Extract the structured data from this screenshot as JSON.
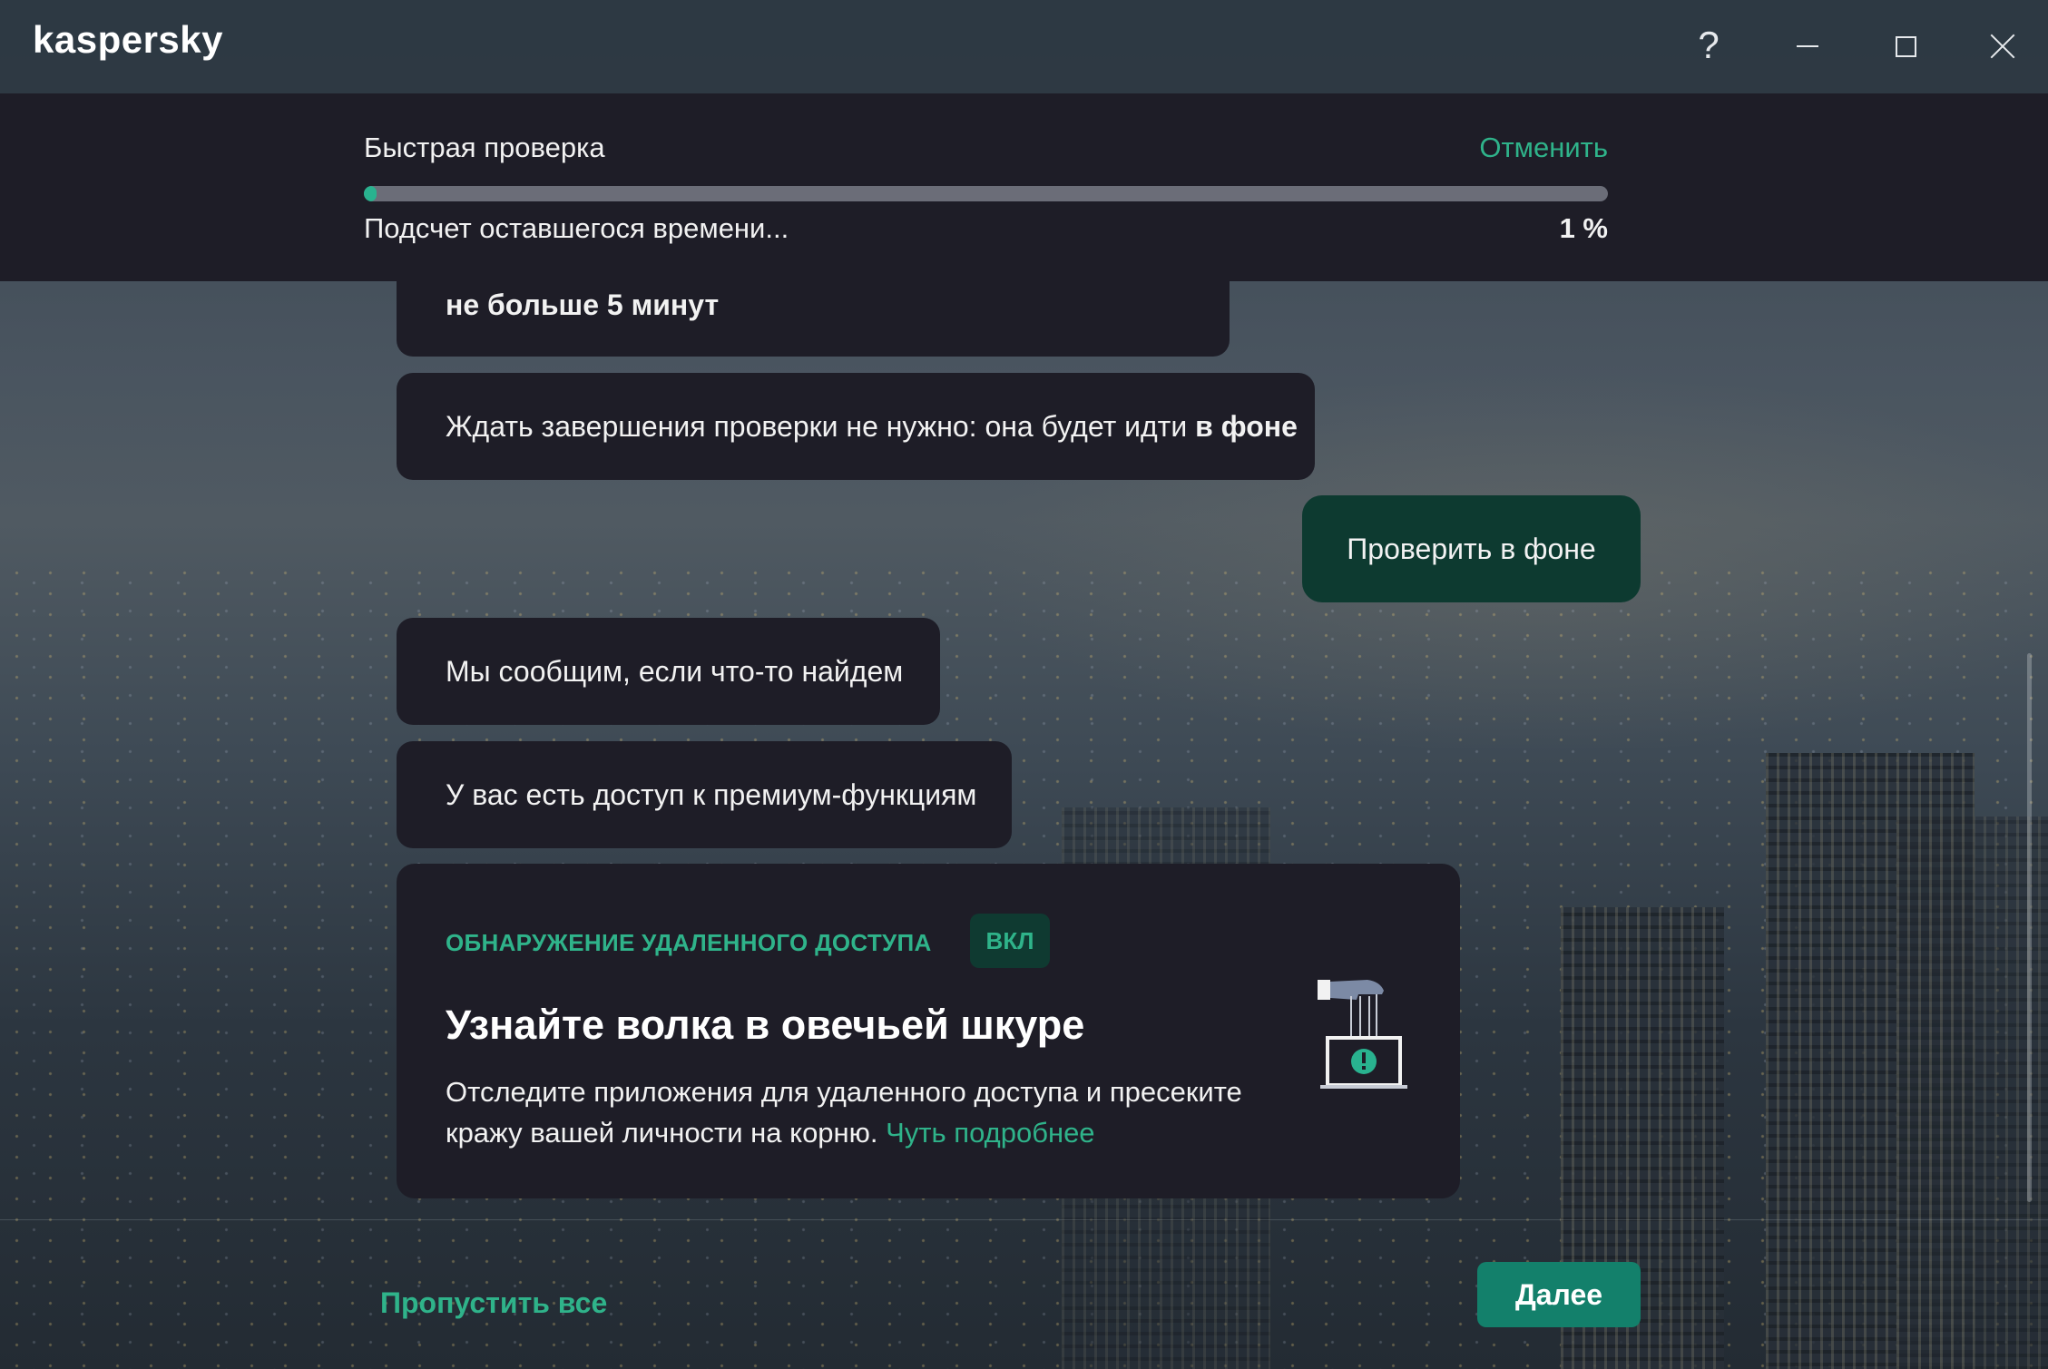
{
  "app": {
    "logo": "kaspersky",
    "help_label": "?"
  },
  "scan": {
    "title": "Быстрая проверка",
    "cancel_label": "Отменить",
    "status": "Подсчет оставшегося времени...",
    "percent_label": "1 %",
    "progress_fraction": 0.01,
    "accent_color": "#29b28f"
  },
  "chat": {
    "msg_duration": "не больше 5 минут",
    "msg_background_prefix": "Ждать завершения проверки не нужно: она будет идти ",
    "msg_background_bold": "в фоне",
    "reply_button": "Проверить в фоне",
    "msg_notify": "Мы сообщим, если что-то найдем",
    "msg_premium": "У вас есть доступ к премиум-функциям"
  },
  "feature_card": {
    "kicker": "ОБНАРУЖЕНИЕ УДАЛЕННОГО ДОСТУПА",
    "badge": "ВКЛ",
    "title": "Узнайте волка в овечьей шкуре",
    "text": "Отследите приложения для удаленного доступа и пресеките кражу вашей личности на корню. ",
    "link": "Чуть подробнее",
    "illustration_icon": "remote-control-laptop-icon"
  },
  "footer": {
    "skip_all": "Пропустить все",
    "next": "Далее"
  }
}
